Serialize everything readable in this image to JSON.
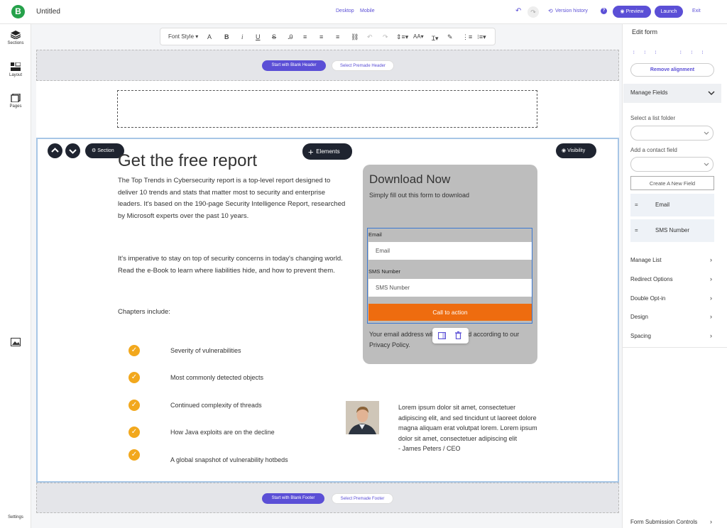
{
  "app": {
    "logo_letter": "B",
    "title": "Untitled",
    "device_tabs": [
      "Desktop",
      "Mobile"
    ],
    "version_history": "Version history",
    "help": "?",
    "preview": "Preview",
    "launch": "Launch",
    "exit": "Exit",
    "accent": "#5b4fd6"
  },
  "left_rail": {
    "items": [
      {
        "label": "Sections",
        "icon": "layers-icon"
      },
      {
        "label": "Layout",
        "icon": "layout-icon"
      },
      {
        "label": "Pages",
        "icon": "pages-icon"
      }
    ],
    "image_icon": "image-icon",
    "settings": "Settings"
  },
  "toolbar": {
    "font_style": "Font Style"
  },
  "header_zone": {
    "blank": "Start with Blank Header",
    "premade": "Select Premade Header"
  },
  "section": {
    "label": "Section",
    "elements": "Elements",
    "visibility": "Visibility",
    "headline": "Get the free report",
    "para1": "The Top Trends in Cybersecurity report is a top-level report designed to deliver 10 trends and stats that matter most to security and enterprise leaders. It's based on the 190-page Security Intelligence Report, researched by Microsoft experts over the past 10 years.",
    "para2": "It's imperative to stay on top of security concerns in today's changing world. Read the e-Book to learn where liabilities hide, and how to prevent them.",
    "chapters_label": "Chapters include:",
    "chapters": [
      "Severity of vulnerabilities",
      "Most commonly detected objects",
      "Continued complexity of threads",
      "How Java exploits are on the decline",
      "A global snapshot of vulnerability hotbeds"
    ],
    "checkmark_color": "#f2a81d"
  },
  "form": {
    "title": "Download Now",
    "subtitle": "Simply fill out this form to download",
    "email_label": "Email",
    "email_placeholder": "Email",
    "sms_label": "SMS Number",
    "sms_placeholder": "SMS Number",
    "cta": "Call to action",
    "cta_color": "#ee6c0f",
    "privacy": "Your email address will be managed according to our Privacy Policy."
  },
  "testimonial": {
    "quote_1": "Lorem ipsum dolor sit amet, consectetuer adipiscing elit, and sed tincidunt ut laoreet dolore magna aliquam erat volutpat lorem. Lorem ipsum dolor sit amet, consectetuer adipiscing elit",
    "quote_2": "- James Peters / CEO"
  },
  "footer_zone": {
    "blank": "Start with Blank Footer",
    "premade": "Select Premade Footer"
  },
  "right_panel": {
    "title": "Edit form",
    "remove_alignment": "Remove alignment",
    "manage_fields": "Manage Fields",
    "select_list_folder": "Select a list folder",
    "add_contact_field": "Add a contact field",
    "create_new_field": "Create A New Field",
    "fields": [
      "Email",
      "SMS Number"
    ],
    "sections": [
      "Manage List",
      "Redirect Options",
      "Double Opt-in",
      "Design",
      "Spacing"
    ],
    "form_submission_controls": "Form Submission Controls"
  }
}
